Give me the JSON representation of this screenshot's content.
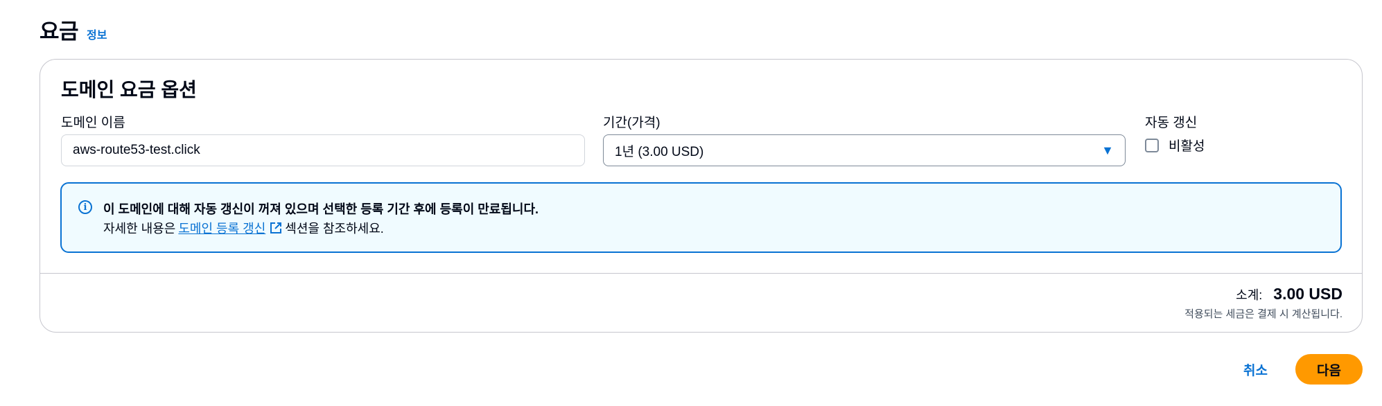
{
  "section": {
    "title": "요금",
    "info_link": "정보"
  },
  "pricing_options": {
    "title": "도메인 요금 옵션",
    "domain_name": {
      "label": "도메인 이름",
      "value": "aws-route53-test.click"
    },
    "duration": {
      "label": "기간(가격)",
      "selected": "1년 (3.00 USD)"
    },
    "auto_renew": {
      "label": "자동 갱신",
      "checkbox_label": "비활성",
      "checked": false
    },
    "alert": {
      "header": "이 도메인에 대해 자동 갱신이 꺼져 있으며 선택한 등록 기간 후에 등록이 만료됩니다.",
      "body_prefix": "자세한 내용은",
      "link_text": "도메인 등록 갱신",
      "body_suffix": "섹션을 참조하세요."
    },
    "subtotal": {
      "label": "소계:",
      "value": "3.00 USD",
      "tax_note": "적용되는 세금은 결제 시 계산됩니다."
    }
  },
  "actions": {
    "cancel_label": "취소",
    "next_label": "다음"
  },
  "colors": {
    "accent": "#0972d3",
    "primary_button": "#ff9900",
    "alert_background": "#f0fbff"
  },
  "icons": {
    "info": "info-circle-icon",
    "external": "external-link-icon",
    "dropdown": "caret-down-icon"
  }
}
